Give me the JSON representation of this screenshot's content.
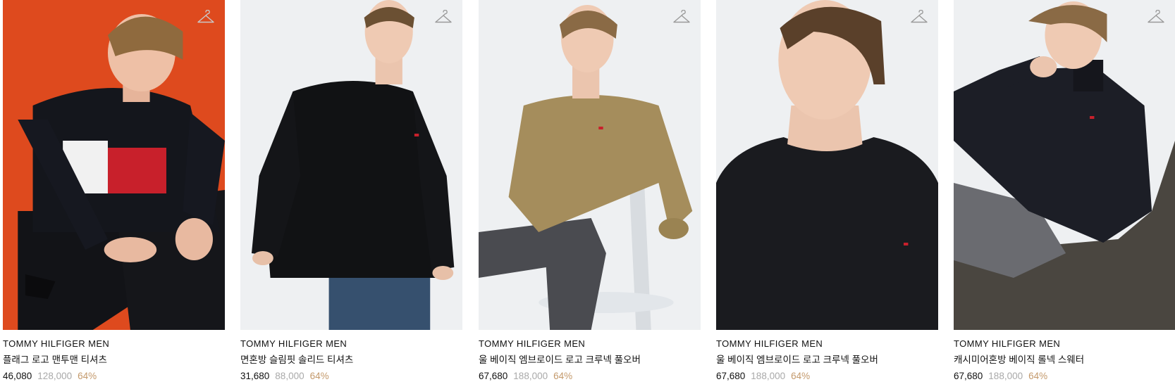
{
  "products": [
    {
      "brand": "TOMMY HILFIGER MEN",
      "name": "플래그 로고 맨투맨 티셔츠",
      "sale_price": "46,080",
      "original_price": "128,000",
      "discount": "64%",
      "background": "#de4a1e",
      "garment_color": "#14161c",
      "icon": "hanger-icon"
    },
    {
      "brand": "TOMMY HILFIGER MEN",
      "name": "면혼방 슬림핏 솔리드 티셔츠",
      "sale_price": "31,680",
      "original_price": "88,000",
      "discount": "64%",
      "background": "#eef0f2",
      "garment_color": "#111214",
      "icon": "hanger-icon"
    },
    {
      "brand": "TOMMY HILFIGER MEN",
      "name": "울 베이직 엠브로이드 로고 크루넥 풀오버",
      "sale_price": "67,680",
      "original_price": "188,000",
      "discount": "64%",
      "background": "#eef0f2",
      "garment_color": "#a58d5c",
      "icon": "hanger-icon"
    },
    {
      "brand": "TOMMY HILFIGER MEN",
      "name": "울 베이직 엠브로이드 로고 크루넥 풀오버",
      "sale_price": "67,680",
      "original_price": "188,000",
      "discount": "64%",
      "background": "#eef0f2",
      "garment_color": "#1a1b1f",
      "icon": "hanger-icon"
    },
    {
      "brand": "TOMMY HILFIGER MEN",
      "name": "캐시미어혼방 베이직 롤넥 스웨터",
      "sale_price": "67,680",
      "original_price": "188,000",
      "discount": "64%",
      "background": "#eef0f2",
      "garment_color": "#1c1e26",
      "icon": "hanger-icon"
    }
  ]
}
